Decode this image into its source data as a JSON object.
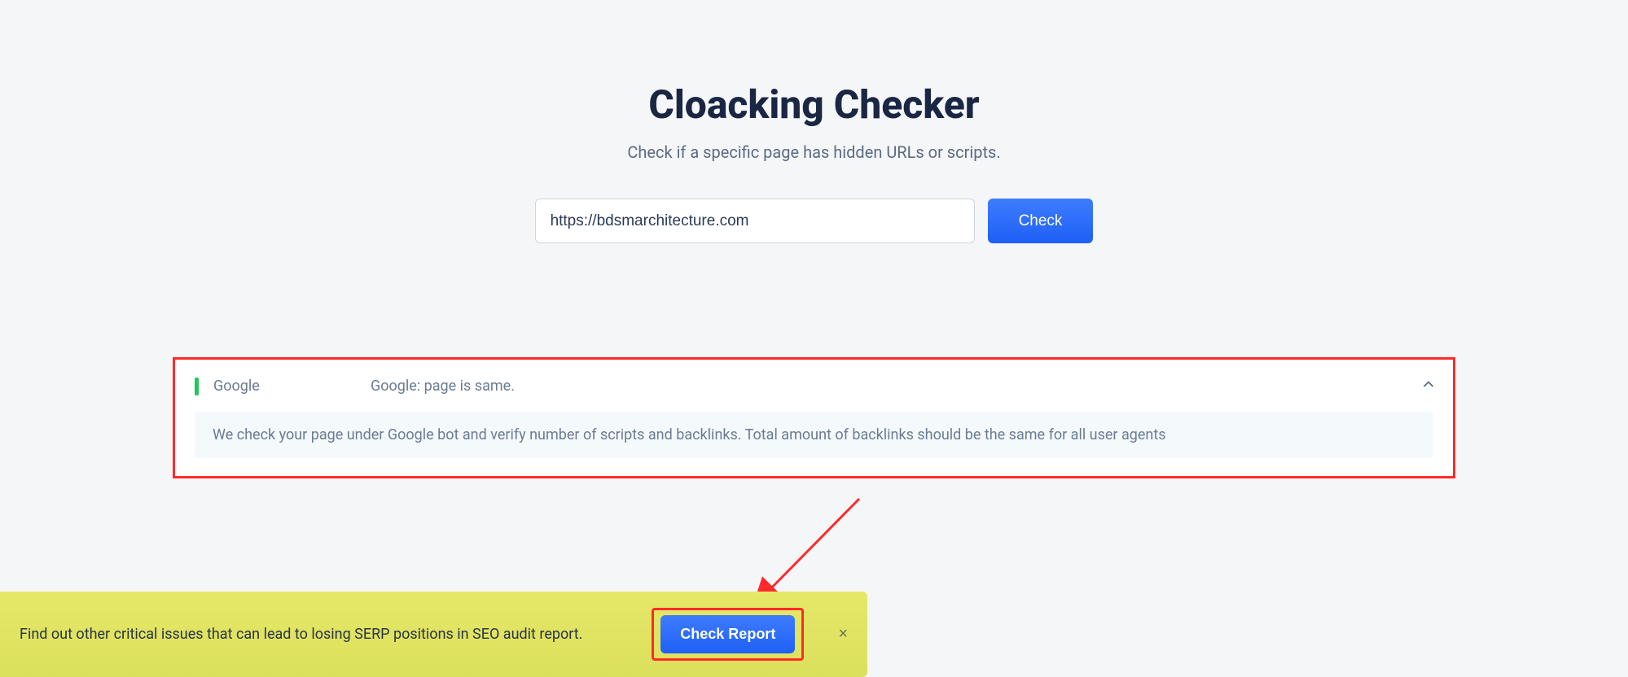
{
  "header": {
    "title": "Cloacking Checker",
    "subtitle": "Check if a specific page has hidden URLs or scripts."
  },
  "form": {
    "url_value": "https://bdsmarchitecture.com",
    "check_label": "Check"
  },
  "result": {
    "provider": "Google",
    "status": "Google: page is same.",
    "description": "We check your page under Google bot and verify number of scripts and backlinks. Total amount of backlinks should be the same for all user agents",
    "status_color": "#22c55e"
  },
  "banner": {
    "text": "Find out other critical issues that can lead to losing SERP positions in SEO audit report.",
    "button_label": "Check Report",
    "close_label": "×"
  }
}
